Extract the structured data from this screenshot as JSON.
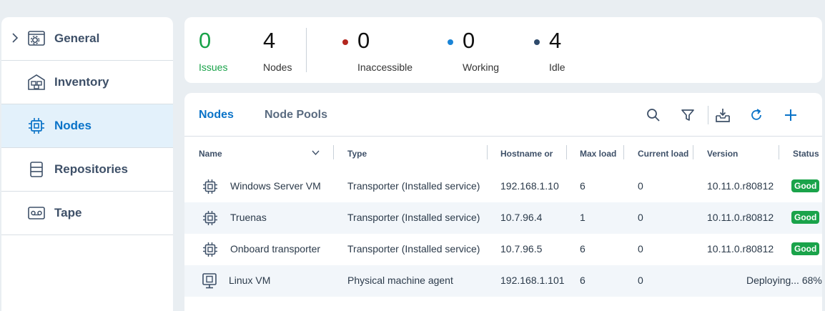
{
  "sidebar": {
    "items": [
      {
        "label": "General",
        "icon": "gear-window-icon",
        "expandable": true
      },
      {
        "label": "Inventory",
        "icon": "inventory-icon"
      },
      {
        "label": "Nodes",
        "icon": "chip-icon",
        "active": true
      },
      {
        "label": "Repositories",
        "icon": "database-icon"
      },
      {
        "label": "Tape",
        "icon": "tape-icon"
      }
    ]
  },
  "summary": {
    "issues": {
      "value": "0",
      "label": "Issues"
    },
    "nodes": {
      "value": "4",
      "label": "Nodes"
    },
    "inaccessible": {
      "value": "0",
      "label": "Inaccessible",
      "color": "#b3261e"
    },
    "working": {
      "value": "0",
      "label": "Working",
      "color": "#1a84d6"
    },
    "idle": {
      "value": "4",
      "label": "Idle",
      "color": "#2e4a6b"
    }
  },
  "tabs": [
    {
      "label": "Nodes",
      "active": true
    },
    {
      "label": "Node Pools",
      "active": false
    }
  ],
  "toolbar": [
    "search-icon",
    "filter-icon",
    "import-icon",
    "refresh-icon",
    "add-icon"
  ],
  "table": {
    "columns": [
      "Name",
      "Type",
      "Hostname or",
      "Max load",
      "Current load",
      "Version",
      "Status"
    ],
    "rows": [
      {
        "name": "Windows Server VM",
        "type": "Transporter (Installed service)",
        "host": "192.168.1.10",
        "max": "6",
        "current": "0",
        "version": "10.11.0.r80812",
        "status": "Good",
        "icon": "chip-icon"
      },
      {
        "name": "Truenas",
        "type": "Transporter (Installed service)",
        "host": "10.7.96.4",
        "max": "1",
        "current": "0",
        "version": "10.11.0.r80812",
        "status": "Good",
        "icon": "chip-icon"
      },
      {
        "name": "Onboard transporter",
        "type": "Transporter (Installed service)",
        "host": "10.7.96.5",
        "max": "6",
        "current": "0",
        "version": "10.11.0.r80812",
        "status": "Good",
        "icon": "chip-icon"
      },
      {
        "name": "Linux VM",
        "type": "Physical machine agent",
        "host": "192.168.1.101",
        "max": "6",
        "current": "0",
        "version": "",
        "status": "Deploying... 68%",
        "icon": "monitor-chip-icon"
      }
    ]
  },
  "colors": {
    "accent": "#0a73c8",
    "good": "#1aa34a"
  }
}
